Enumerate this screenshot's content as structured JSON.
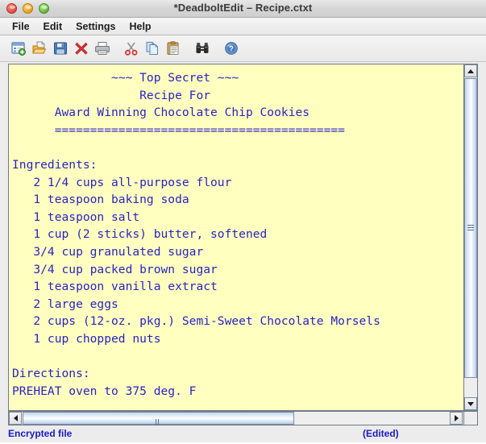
{
  "window": {
    "title": "*DeadboltEdit – Recipe.ctxt",
    "traffic_lights": [
      {
        "name": "close",
        "color": "#e04a3f"
      },
      {
        "name": "minimize",
        "color": "#e8a01c"
      },
      {
        "name": "zoom",
        "color": "#64b43c"
      }
    ]
  },
  "menubar": {
    "items": [
      {
        "label": "File"
      },
      {
        "label": "Edit"
      },
      {
        "label": "Settings"
      },
      {
        "label": "Help"
      }
    ]
  },
  "toolbar": {
    "buttons": [
      {
        "name": "new-file-icon",
        "tooltip": "New"
      },
      {
        "name": "open-folder-icon",
        "tooltip": "Open"
      },
      {
        "name": "save-floppy-icon",
        "tooltip": "Save"
      },
      {
        "name": "close-x-icon",
        "tooltip": "Close"
      },
      {
        "name": "print-icon",
        "tooltip": "Print"
      },
      {
        "name": "cut-scissors-icon",
        "tooltip": "Cut"
      },
      {
        "name": "copy-icon",
        "tooltip": "Copy"
      },
      {
        "name": "paste-clipboard-icon",
        "tooltip": "Paste"
      },
      {
        "name": "find-binoculars-icon",
        "tooltip": "Find"
      },
      {
        "name": "help-question-icon",
        "tooltip": "Help"
      }
    ]
  },
  "editor": {
    "background_color": "#ffffbf",
    "text_color": "#2a23c8",
    "content": "              ~~~ Top Secret ~~~\n                  Recipe For\n      Award Winning Chocolate Chip Cookies\n      =========================================\n\nIngredients:\n   2 1/4 cups all-purpose flour\n   1 teaspoon baking soda\n   1 teaspoon salt\n   1 cup (2 sticks) butter, softened\n   3/4 cup granulated sugar\n   3/4 cup packed brown sugar\n   1 teaspoon vanilla extract\n   2 large eggs\n   2 cups (12-oz. pkg.) Semi-Sweet Chocolate Morsels\n   1 cup chopped nuts\n\nDirections:\nPREHEAT oven to 375 deg. F"
  },
  "scrollbars": {
    "vertical": {
      "up_arrow": "▲",
      "down_arrow": "▼"
    },
    "horizontal": {
      "left_arrow": "◀",
      "right_arrow": "▶"
    }
  },
  "statusbar": {
    "left_text": "Encrypted file",
    "right_text": "(Edited)",
    "text_color": "#1a19c8"
  }
}
